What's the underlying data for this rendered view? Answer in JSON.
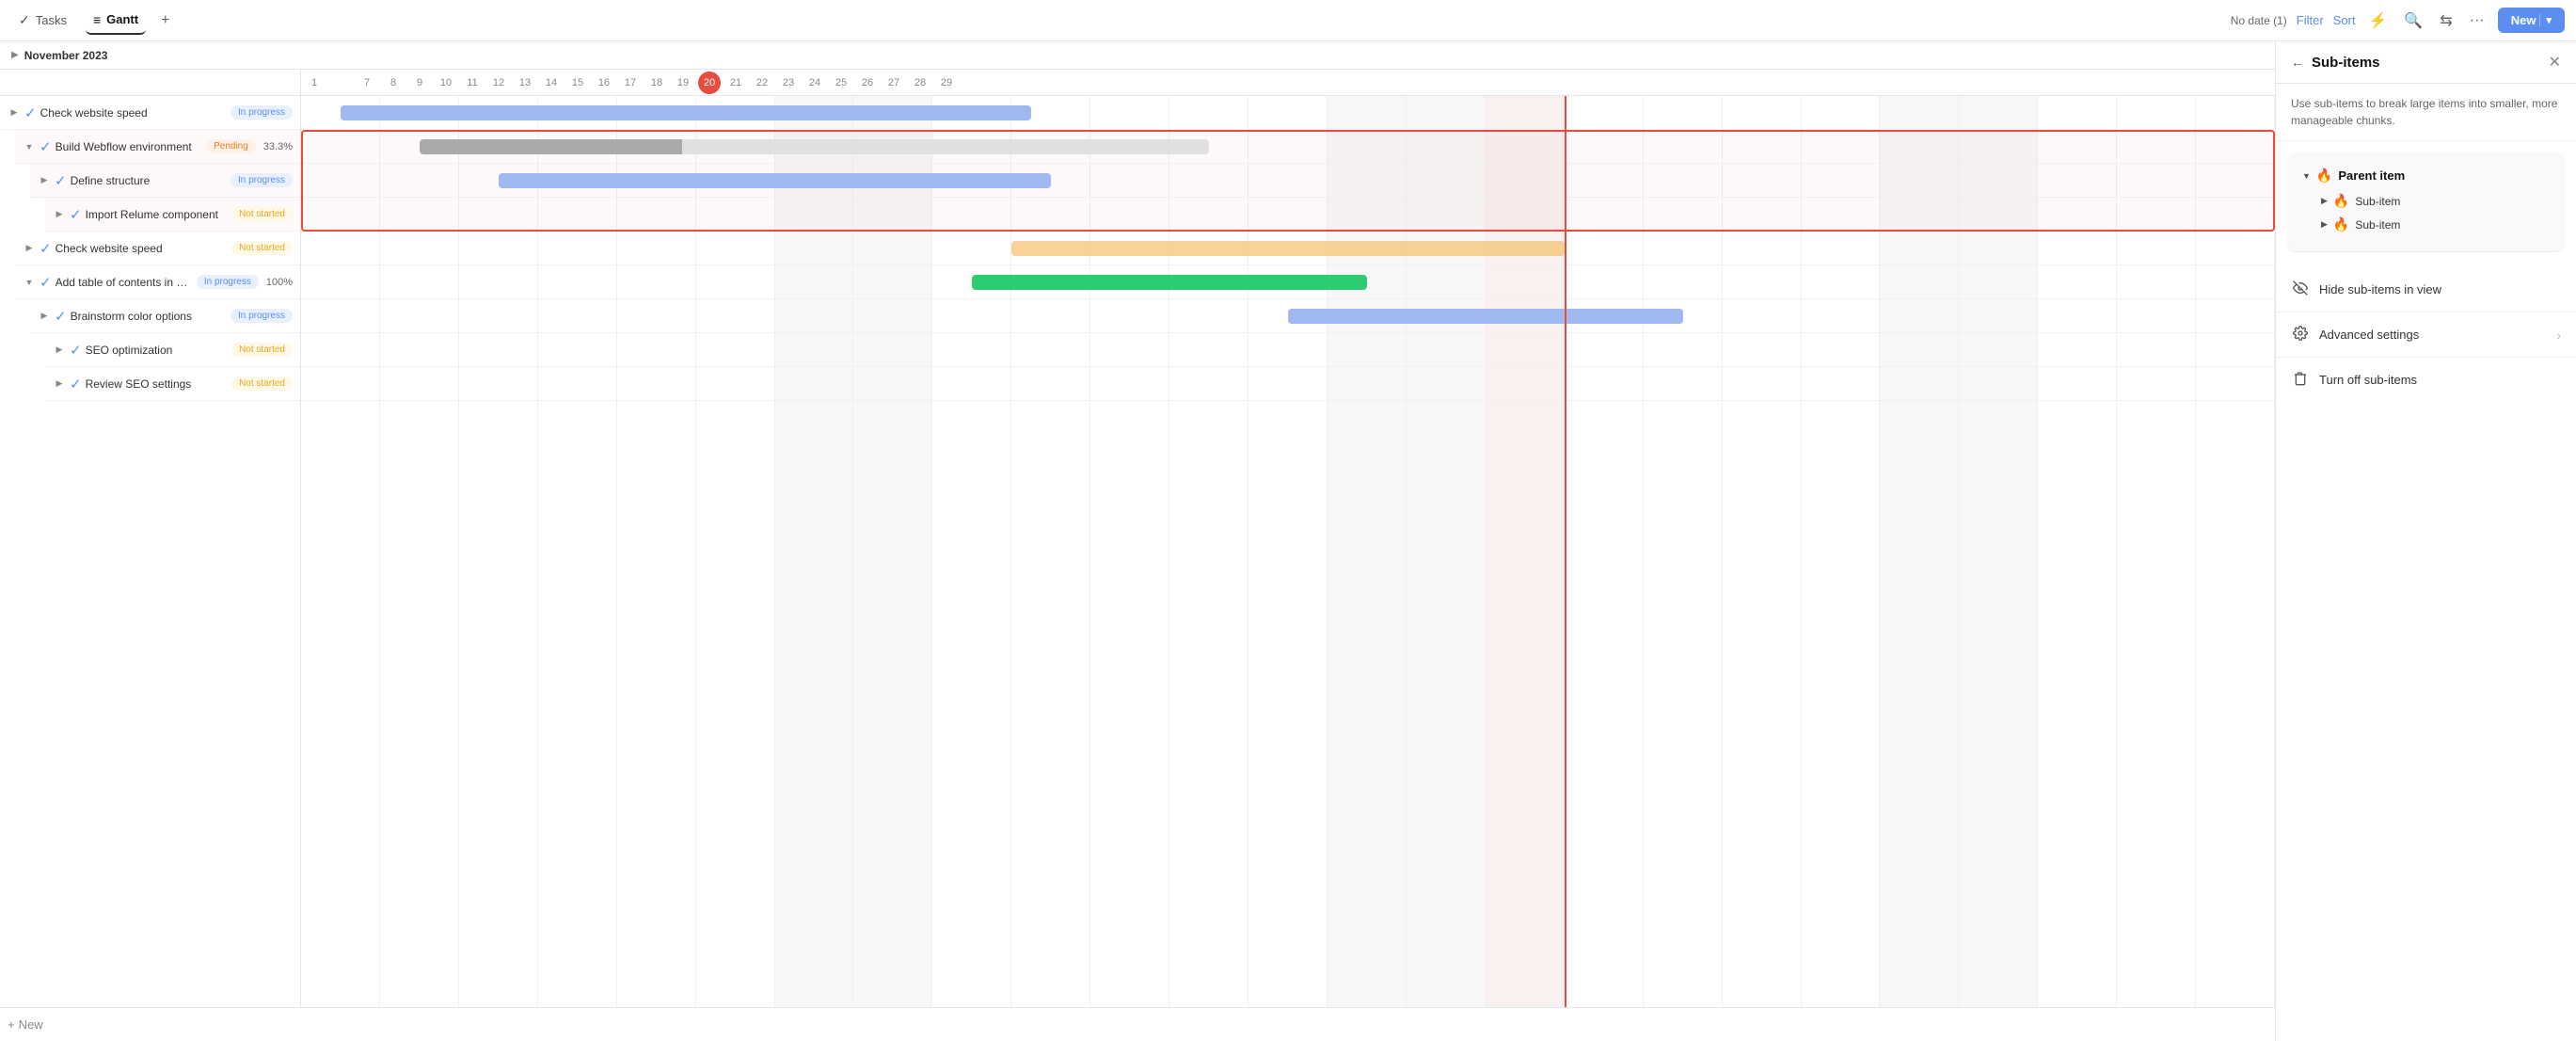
{
  "tabs": [
    {
      "id": "tasks",
      "label": "Tasks",
      "icon": "✓",
      "active": false
    },
    {
      "id": "gantt",
      "label": "Gantt",
      "icon": "≡",
      "active": true
    }
  ],
  "topbar": {
    "add_icon": "+",
    "no_date": "No date (1)",
    "filter_label": "Filter",
    "sort_label": "Sort",
    "new_label": "New",
    "new_arrow": "▾"
  },
  "month": {
    "toggle": "▶",
    "label": "November 2023"
  },
  "days": [
    "1",
    "",
    "7",
    "8",
    "9",
    "10",
    "11",
    "12",
    "13",
    "14",
    "15",
    "16",
    "17",
    "18",
    "19",
    "20",
    "21",
    "22",
    "23",
    "24",
    "25",
    "26",
    "27",
    "28",
    "29"
  ],
  "today_day": "20",
  "tasks": [
    {
      "id": 1,
      "indent": 0,
      "expand": "▶",
      "checked": true,
      "name": "Check website speed",
      "status": "In progress",
      "status_class": "status-in-progress",
      "pct": ""
    },
    {
      "id": 2,
      "indent": 1,
      "expand": "▼",
      "checked": true,
      "name": "Build Webflow environment",
      "status": "Pending",
      "status_class": "status-pending",
      "pct": "33.3%",
      "highlighted": true
    },
    {
      "id": 3,
      "indent": 2,
      "expand": "▶",
      "checked": true,
      "name": "Define structure",
      "status": "In progress",
      "status_class": "status-in-progress",
      "pct": "",
      "highlighted": true
    },
    {
      "id": 4,
      "indent": 3,
      "expand": "▶",
      "checked": true,
      "name": "Import Relume component",
      "status": "Not started",
      "status_class": "status-not-started",
      "pct": "",
      "highlighted": true
    },
    {
      "id": 5,
      "indent": 1,
      "expand": "▶",
      "checked": true,
      "name": "Check website speed",
      "status": "Not started",
      "status_class": "status-not-started",
      "pct": ""
    },
    {
      "id": 6,
      "indent": 1,
      "expand": "▼",
      "checked": true,
      "name": "Add table of contents in CMS",
      "status": "In progress",
      "status_class": "status-in-progress",
      "pct": "100%",
      "bar_green": true
    },
    {
      "id": 7,
      "indent": 2,
      "expand": "▶",
      "checked": true,
      "name": "Brainstorm color options",
      "status": "In progress",
      "status_class": "status-in-progress",
      "pct": ""
    },
    {
      "id": 8,
      "indent": 3,
      "expand": "▶",
      "checked": true,
      "name": "SEO optimization",
      "status": "Not started",
      "status_class": "status-not-started",
      "pct": ""
    },
    {
      "id": 9,
      "indent": 3,
      "expand": "▶",
      "checked": true,
      "name": "Review SEO settings",
      "status": "Not started",
      "status_class": "status-not-started",
      "pct": ""
    }
  ],
  "bottom_bar": {
    "add_icon": "+",
    "label": "New"
  },
  "right_panel": {
    "back_icon": "←",
    "title": "Sub-items",
    "close_icon": "✕",
    "description": "Use sub-items to break large items into smaller, more manageable chunks.",
    "tree": {
      "parent_arrow": "▼",
      "parent_emoji": "🔥",
      "parent_label": "Parent item",
      "children": [
        {
          "arrow": "▶",
          "emoji": "🔥",
          "label": "Sub-item"
        },
        {
          "arrow": "▶",
          "emoji": "🔥",
          "label": "Sub-item"
        }
      ]
    },
    "actions": [
      {
        "icon": "👁",
        "label": "Hide sub-items in view",
        "arrow": ""
      },
      {
        "icon": "⚙",
        "label": "Advanced settings",
        "arrow": "›"
      },
      {
        "icon": "🗑",
        "label": "Turn off sub-items",
        "arrow": ""
      }
    ]
  }
}
